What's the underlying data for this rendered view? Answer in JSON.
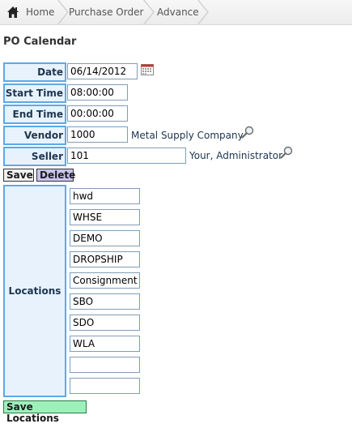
{
  "breadcrumb": {
    "home": "Home",
    "items": [
      "Purchase Order",
      "Advance"
    ]
  },
  "title": "PO Calendar",
  "form": {
    "date_label": "Date",
    "date_value": "06/14/2012",
    "start_time_label": "Start Time",
    "start_time_value": "08:00:00",
    "end_time_label": "End Time",
    "end_time_value": "00:00:00",
    "vendor_label": "Vendor",
    "vendor_value": "1000",
    "vendor_name": "Metal Supply Company",
    "seller_label": "Seller",
    "seller_value": "101",
    "seller_name": "Your, Administrator"
  },
  "buttons": {
    "save": "Save",
    "delete": "Delete",
    "save_locations": "Save Locations"
  },
  "locations": {
    "label": "Locations",
    "values": [
      "hwd",
      "WHSE",
      "DEMO",
      "DROPSHIP",
      "Consignment",
      "SBO",
      "SDO",
      "WLA",
      "",
      ""
    ]
  },
  "icons": {
    "home": "home-icon",
    "calendar": "calendar-icon",
    "lookup": "magnifier-icon"
  },
  "colors": {
    "label_border": "#5fa8e6",
    "label_bg": "#e8f2fd",
    "delete_bg": "#c9c4ee",
    "save_locations_bg": "#9ef0bb"
  }
}
